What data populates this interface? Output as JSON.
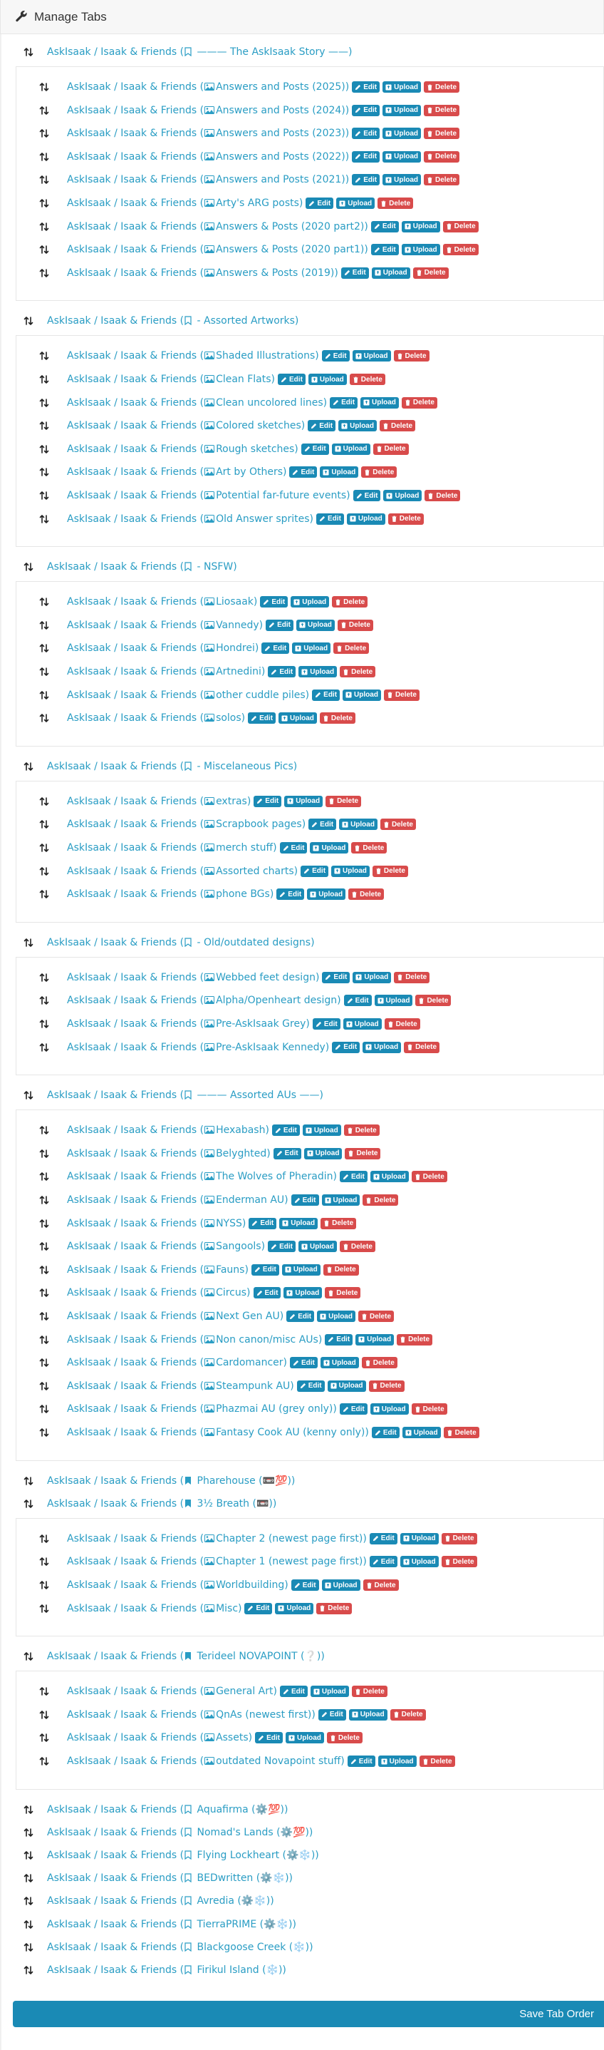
{
  "header": {
    "title": "Manage Tabs"
  },
  "save_button": "Save Tab Order",
  "buttons": {
    "edit": "Edit",
    "upload": "Upload",
    "delete": "Delete"
  },
  "groups": [
    {
      "label": "AskIsaak / Isaak & Friends (",
      "icon": "bookmark-outline",
      "name": " ——— The AskIsaak Story ——)",
      "children": [
        "Answers and Posts (2025))",
        "Answers and Posts (2024))",
        "Answers and Posts (2023))",
        "Answers and Posts (2022))",
        "Answers and Posts (2021))",
        "Arty's ARG posts)",
        "Answers & Posts (2020 part2))",
        "Answers & Posts (2020 part1))",
        "Answers & Posts (2019))"
      ]
    },
    {
      "label": "AskIsaak / Isaak & Friends (",
      "icon": "bookmark-outline",
      "name": " - Assorted Artworks)",
      "children": [
        "Shaded Illustrations)",
        "Clean Flats)",
        "Clean uncolored lines)",
        "Colored sketches)",
        "Rough sketches)",
        "Art by Others)",
        "Potential far-future events)",
        "Old Answer sprites)"
      ]
    },
    {
      "label": "AskIsaak / Isaak & Friends (",
      "icon": "bookmark-outline",
      "name": " - NSFW)",
      "children": [
        "Liosaak)",
        "Vannedy)",
        "Hondrei)",
        "Artnedini)",
        "other cuddle piles)",
        "solos)"
      ]
    },
    {
      "label": "AskIsaak / Isaak & Friends (",
      "icon": "bookmark-outline",
      "name": " - Miscelaneous Pics)",
      "children": [
        "extras)",
        "Scrapbook pages)",
        "merch stuff)",
        "Assorted charts)",
        "phone BGs)"
      ]
    },
    {
      "label": "AskIsaak / Isaak & Friends (",
      "icon": "bookmark-outline",
      "name": " - Old/outdated designs)",
      "children": [
        "Webbed feet design)",
        "Alpha/Openheart design)",
        "Pre-AskIsaak Grey)",
        "Pre-AskIsaak Kennedy)"
      ]
    },
    {
      "label": "AskIsaak / Isaak & Friends (",
      "icon": "bookmark-outline",
      "name": " ——— Assorted AUs ——)",
      "children": [
        "Hexabash)",
        "Belyghted)",
        "The Wolves of Pheradin)",
        "Enderman AU)",
        "NYSS)",
        "Sangools)",
        "Fauns)",
        "Circus)",
        "Next Gen AU)",
        "Non canon/misc AUs)",
        "Cardomancer)",
        "Steampunk AU)",
        "Phazmai AU (grey only))",
        "Fantasy Cook AU (kenny only))"
      ]
    },
    {
      "label": "AskIsaak / Isaak & Friends (",
      "icon": "bookmark-filled",
      "name": " Pharehouse (📼💯))",
      "children": []
    },
    {
      "label": "AskIsaak / Isaak & Friends (",
      "icon": "bookmark-filled",
      "name": " 3½ Breath (📼))",
      "children": [
        "Chapter 2 (newest page first))",
        "Chapter 1 (newest page first))",
        "Worldbuilding)",
        "Misc)"
      ]
    },
    {
      "label": "AskIsaak / Isaak & Friends (",
      "icon": "bookmark-filled",
      "name": " Terideel NOVAPOINT (❔))",
      "children": [
        "General Art)",
        "QnAs (newest first))",
        "Assets)",
        "outdated Novapoint stuff)"
      ]
    },
    {
      "label": "AskIsaak / Isaak & Friends (",
      "icon": "bookmark-outline",
      "name": " Aquafirma (⚙️💯))",
      "children": []
    },
    {
      "label": "AskIsaak / Isaak & Friends (",
      "icon": "bookmark-outline",
      "name": " Nomad's Lands (⚙️💯))",
      "children": []
    },
    {
      "label": "AskIsaak / Isaak & Friends (",
      "icon": "bookmark-outline",
      "name": " Flying Lockheart (⚙️❄️))",
      "children": []
    },
    {
      "label": "AskIsaak / Isaak & Friends (",
      "icon": "bookmark-outline",
      "name": " BEDwritten (⚙️❄️))",
      "children": []
    },
    {
      "label": "AskIsaak / Isaak & Friends (",
      "icon": "bookmark-outline",
      "name": " Avredia (⚙️❄️))",
      "children": []
    },
    {
      "label": "AskIsaak / Isaak & Friends (",
      "icon": "bookmark-outline",
      "name": " TierraPRIME (⚙️❄️))",
      "children": []
    },
    {
      "label": "AskIsaak / Isaak & Friends (",
      "icon": "bookmark-outline",
      "name": " Blackgoose Creek (❄️))",
      "children": []
    },
    {
      "label": "AskIsaak / Isaak & Friends (",
      "icon": "bookmark-outline",
      "name": " Firikul Island (❄️))",
      "children": []
    }
  ]
}
